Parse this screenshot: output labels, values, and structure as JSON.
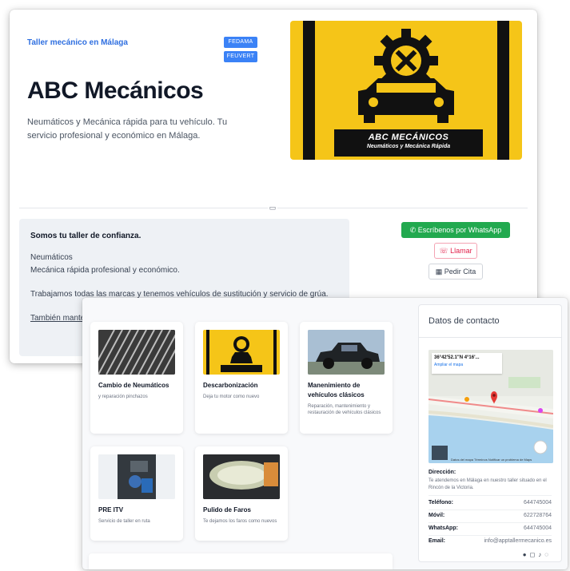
{
  "header": {
    "kicker": "Taller mecánico en Málaga",
    "badges": [
      "FEDAMA",
      "FEUVERT"
    ],
    "title": "ABC Mecánicos",
    "description": "Neumáticos y Mecánica rápida para tu vehículo. Tu servicio profesional y económico en Málaga."
  },
  "logo": {
    "line1": "ABC MECÁNICOS",
    "line2": "Neumáticos y Mecánica Rápida"
  },
  "about": {
    "title": "Somos tu taller de confianza.",
    "line1": "Neumáticos",
    "line2": "Mecánica rápida profesional y económico.",
    "line3": "Trabajamos todas las marcas y tenemos vehículos de sustitución y servicio de grúa.",
    "line4": "También mantenemos"
  },
  "actions": {
    "whatsapp": "Escríbenos por WhatsApp",
    "call": "Llamar",
    "appointment": "Pedir Cita"
  },
  "services": [
    {
      "title": "Cambio de Neumáticos",
      "desc": "y reparación pinchazos"
    },
    {
      "title": "Descarbonización",
      "desc": "Deja tu motor como nuevo"
    },
    {
      "title": "Manenimiento de vehículos clásicos",
      "desc": "Reparación, mantenimiento y restauración de vehículos clásicos"
    },
    {
      "title": "PRE ITV",
      "desc": "Servicio de taller en ruta"
    },
    {
      "title": "Pulido de Faros",
      "desc": "Te dejamos los faros como nuevos"
    }
  ],
  "contact": {
    "title": "Datos de contacto",
    "map_coord": "36°42'52.1\"N 4°16'...",
    "map_link": "Ampliar el mapa",
    "map_footer": "Datos del mapa   Términos   Notificar un problema de Maps",
    "address_label": "Dirección:",
    "address": "Te atendemos en Málaga en nuestro taller situado en el Rincón de la Victoria.",
    "phone_label": "Teléfono:",
    "phone": "644745004",
    "mobile_label": "Móvil:",
    "mobile": "622728764",
    "whatsapp_label": "WhatsApp:",
    "whatsapp": "644745004",
    "email_label": "Email:",
    "email": "info@apptallermecanico.es"
  },
  "colors": {
    "accent": "#3b82f6",
    "whatsapp": "#22a94f",
    "call": "#e11d48",
    "logo_yellow": "#f5c518"
  }
}
